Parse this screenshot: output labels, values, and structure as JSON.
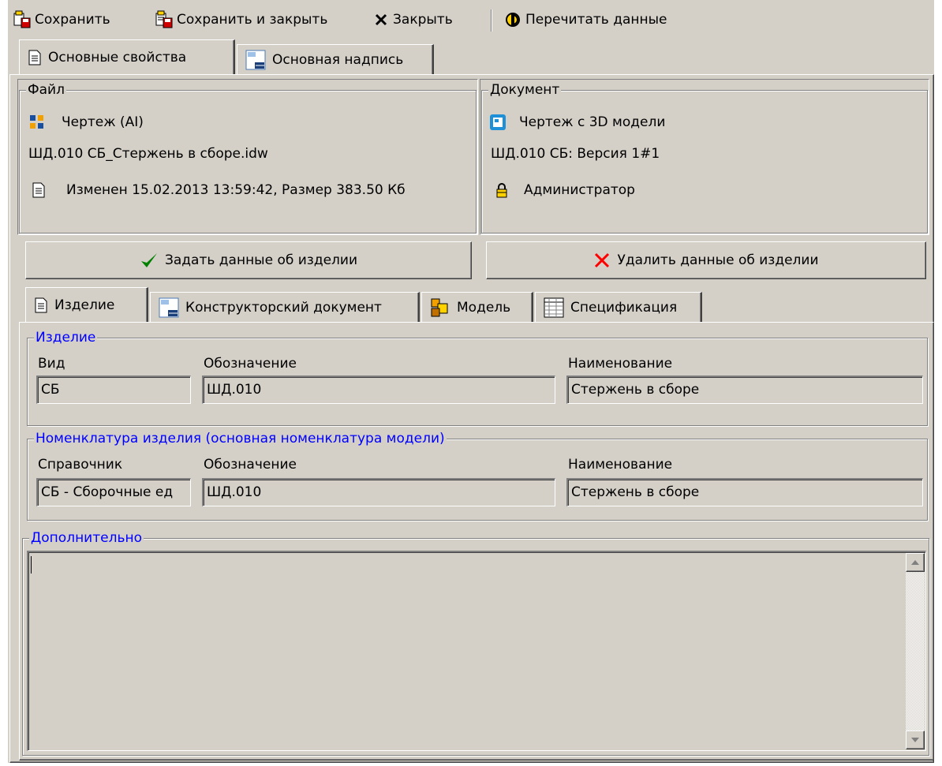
{
  "toolbar": {
    "save": "Сохранить",
    "save_close": "Сохранить и закрыть",
    "close": "Закрыть",
    "reread": "Перечитать данные"
  },
  "main_tabs": [
    {
      "label": "Основные свойства",
      "icon": "document-icon",
      "active": true
    },
    {
      "label": "Основная надпись",
      "icon": "title-block-icon",
      "active": false
    }
  ],
  "file_group": {
    "title": "Файл",
    "type": "Чертеж (AI)",
    "filename": "ШД.010 СБ_Стержень в сборе.idw",
    "modified": "Изменен 15.02.2013 13:59:42, Размер 383.50 Кб"
  },
  "document_group": {
    "title": "Документ",
    "type": "Чертеж с 3D модели",
    "version": "ШД.010 СБ: Версия 1#1",
    "owner": "Администратор"
  },
  "buttons": {
    "set_item": "Задать данные об изделии",
    "delete_item": "Удалить данные об изделии"
  },
  "sub_tabs": [
    {
      "label": "Изделие",
      "icon": "document-icon",
      "active": true
    },
    {
      "label": "Конструкторский документ",
      "icon": "title-block-icon",
      "active": false
    },
    {
      "label": "Модель",
      "icon": "model-icon",
      "active": false
    },
    {
      "label": "Спецификация",
      "icon": "spec-table-icon",
      "active": false
    }
  ],
  "item_group": {
    "title": "Изделие",
    "labels": {
      "kind": "Вид",
      "designation": "Обозначение",
      "name": "Наименование"
    },
    "values": {
      "kind": "СБ",
      "designation": "ШД.010",
      "name": "Стержень в сборе"
    }
  },
  "nomenclature_group": {
    "title": "Номенклатура изделия (основная номенклатура модели)",
    "labels": {
      "directory": "Справочник",
      "designation": "Обозначение",
      "name": "Наименование"
    },
    "values": {
      "directory": "СБ - Сборочные ед",
      "designation": "ШД.010",
      "name": "Стержень в сборе"
    }
  },
  "extra_group": {
    "title": "Дополнительно",
    "text": ""
  },
  "colors": {
    "face": "#d4d0c8",
    "group_title_blue": "#0000ff",
    "check_green": "#008000",
    "cross_red": "#ff0000"
  }
}
